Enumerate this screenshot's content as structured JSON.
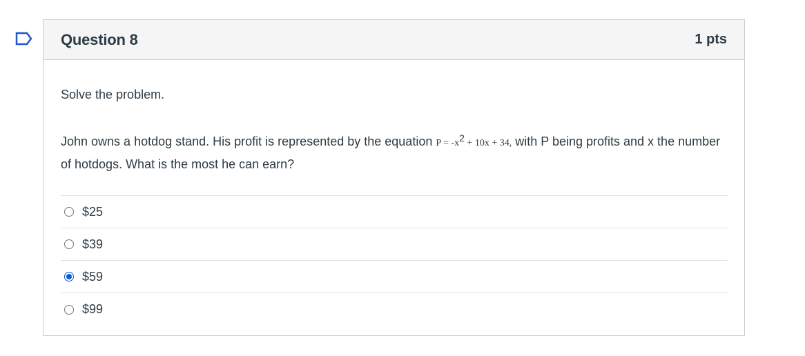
{
  "question": {
    "title": "Question 8",
    "points": "1 pts",
    "instruction": "Solve the problem.",
    "problem_before": "John owns a hotdog stand. His profit is represented by the equation ",
    "equation_lhs": "P = -x",
    "equation_exp": "2",
    "equation_rhs": " + 10x + 34,",
    "problem_after": " with P being profits and x the number of hotdogs. What is the most he can earn?",
    "answers": [
      {
        "label": "$25",
        "selected": false
      },
      {
        "label": "$39",
        "selected": false
      },
      {
        "label": "$59",
        "selected": true
      },
      {
        "label": "$99",
        "selected": false
      }
    ]
  },
  "colors": {
    "accent": "#0b5cd5",
    "text": "#2d3b45",
    "border": "#c7cdd1",
    "header_bg": "#f5f5f5"
  },
  "icons": {
    "flag": "bookmark-flag-icon"
  }
}
